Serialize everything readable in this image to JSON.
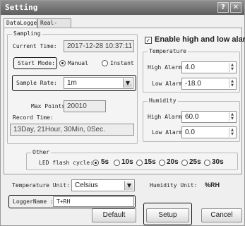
{
  "window": {
    "title": "Setting",
    "help_label": "?",
    "close_label": "✕"
  },
  "tabs": [
    {
      "label": "DataLogger"
    },
    {
      "label": "Real-time"
    }
  ],
  "sampling": {
    "legend": "Sampling",
    "current_time_label": "Current Time:",
    "current_time_value": "2017-12-28 10:37:11",
    "start_mode_label": "Start Mode:",
    "start_mode_options": [
      {
        "label": "Manual",
        "selected": true
      },
      {
        "label": "Instant",
        "selected": false
      }
    ],
    "sample_rate_label": "Sample Rate:",
    "sample_rate_value": "1m",
    "max_points_label": "Max Points:",
    "max_points_value": "20010",
    "record_time_label": "Record Time:",
    "record_time_value": "13Day, 21Hour, 30Min, 0Sec."
  },
  "alarm": {
    "enable_label": "Enable high and low alarm",
    "enabled": true,
    "temperature": {
      "legend": "Temperature",
      "high_label": "High Alarm:",
      "high_value": "4.0",
      "low_label": "Low Alarm:",
      "low_value": "-18.0"
    },
    "humidity": {
      "legend": "Humidity",
      "high_label": "High Alarm:",
      "high_value": "60.0",
      "low_label": "Low Alarm:",
      "low_value": "0.0"
    }
  },
  "other": {
    "legend": "Other",
    "led_label": "LED flash cycle:",
    "led_options": [
      {
        "label": "5s",
        "selected": true
      },
      {
        "label": "10s",
        "selected": false
      },
      {
        "label": "15s",
        "selected": false
      },
      {
        "label": "20s",
        "selected": false
      },
      {
        "label": "25s",
        "selected": false
      },
      {
        "label": "30s",
        "selected": false
      }
    ]
  },
  "bottom": {
    "temp_unit_label": "Temperature Unit:",
    "temp_unit_value": "Celsius",
    "humidity_unit_label": "Humidity Unit:",
    "humidity_unit_value": "%RH",
    "logger_name_label": "LoggerName :",
    "logger_name_value": "T+RH"
  },
  "buttons": {
    "default_label": "Default",
    "setup_label": "Setup",
    "cancel_label": "Cancel"
  },
  "icons": {
    "spin": "spin-arrows-icon",
    "dropdown": "chevron-down-icon",
    "check": "checkmark-icon"
  }
}
